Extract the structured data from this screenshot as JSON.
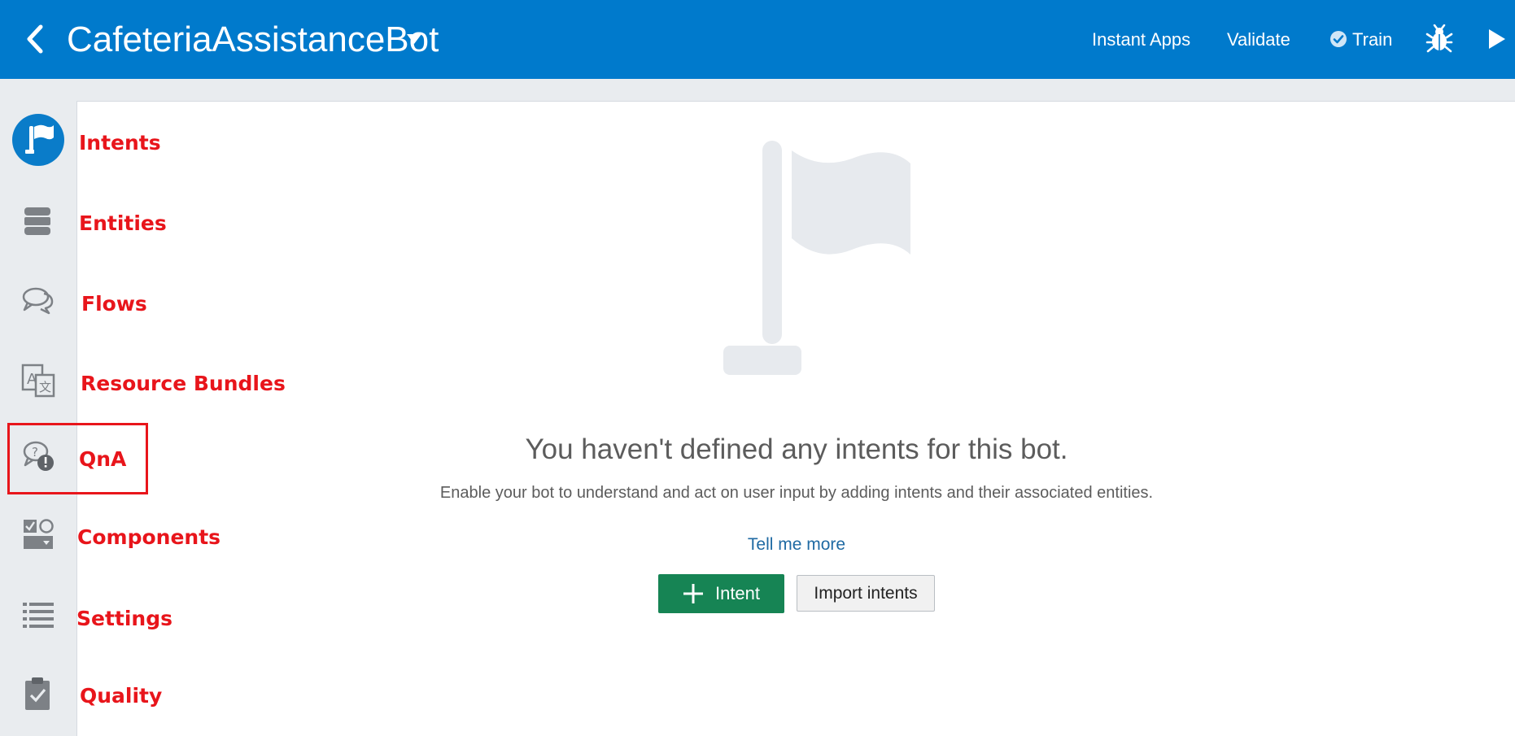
{
  "header": {
    "bot_name": "CafeteriaAssistanceBot",
    "actions": {
      "instant_apps": "Instant Apps",
      "validate": "Validate",
      "train": "Train"
    }
  },
  "sidebar": {
    "items": [
      {
        "icon": "flag-icon",
        "label": "Intents",
        "active": true
      },
      {
        "icon": "database-icon",
        "label": "Entities"
      },
      {
        "icon": "chat-bubbles-icon",
        "label": "Flows"
      },
      {
        "icon": "translate-icon",
        "label": "Resource Bundles"
      },
      {
        "icon": "qna-icon",
        "label": "QnA",
        "highlighted": true
      },
      {
        "icon": "components-icon",
        "label": "Components"
      },
      {
        "icon": "list-icon",
        "label": "Settings"
      },
      {
        "icon": "clipboard-check-icon",
        "label": "Quality"
      }
    ]
  },
  "main": {
    "empty_state": {
      "title": "You haven't defined any intents for this bot.",
      "description": "Enable your bot to understand and act on user input by adding intents and their associated entities.",
      "link": "Tell me more",
      "primary_button": "Intent",
      "secondary_button": "Import intents"
    }
  },
  "colors": {
    "header_bg": "#007acc",
    "active_icon_bg": "#0a7cc9",
    "primary_button": "#168454",
    "annotation_red": "#e8151b",
    "link": "#1f6aa3"
  }
}
